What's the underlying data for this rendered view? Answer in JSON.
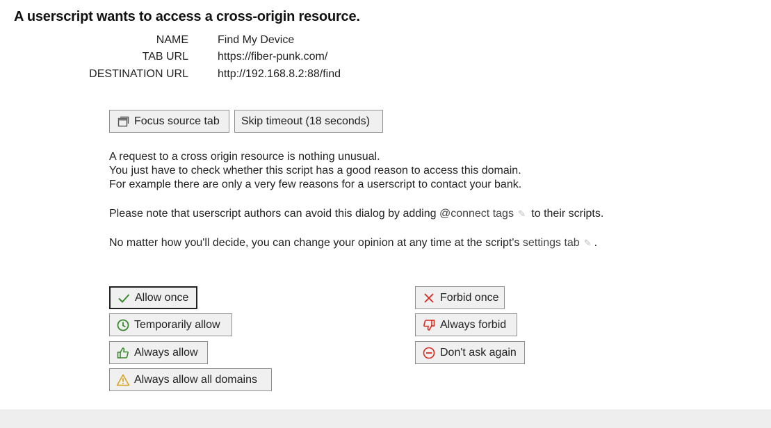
{
  "dialog": {
    "title": "A userscript wants to access a cross-origin resource."
  },
  "info": {
    "name_label": "NAME",
    "name_value": "Find My Device",
    "tab_url_label": "TAB URL",
    "tab_url_value": "https://fiber-punk.com/",
    "destination_label": "DESTINATION URL",
    "destination_value": "http://192.168.8.2:88/find"
  },
  "toolbar": {
    "focus_label": "Focus source tab",
    "skip_label": "Skip timeout (18 seconds)"
  },
  "explanation": {
    "line1": "A request to a cross origin resource is nothing unusual.",
    "line2": "You just have to check whether this script has a good reason to access this domain.",
    "line3": "For example there are only a very few reasons for a userscript to contact your bank.",
    "note_prefix": "Please note that userscript authors can avoid this dialog by adding ",
    "note_link": "@connect tags",
    "note_suffix": " to their scripts.",
    "decide_prefix": "No matter how you'll decide, you can change your opinion at any time at the script's ",
    "decide_link": "settings tab",
    "decide_suffix": "."
  },
  "allow_options": {
    "allow_once": "Allow once",
    "temporarily_allow": "Temporarily allow",
    "always_allow": "Always allow",
    "always_allow_all": "Always allow all domains"
  },
  "forbid_options": {
    "forbid_once": "Forbid once",
    "always_forbid": "Always forbid",
    "dont_ask_again": "Don't ask again"
  },
  "icons": {
    "window": "window-icon",
    "check": "check-icon",
    "clock": "clock-icon",
    "thumbs_up": "thumbs-up-icon",
    "warning": "warning-icon",
    "close": "x-icon",
    "thumbs_down": "thumbs-down-icon",
    "minus_circle": "minus-circle-icon",
    "pencil": "pencil-icon"
  },
  "colors": {
    "allow_green": "#3a8a2e",
    "forbid_red": "#d62b1f",
    "warning_amber": "#d9a420"
  }
}
